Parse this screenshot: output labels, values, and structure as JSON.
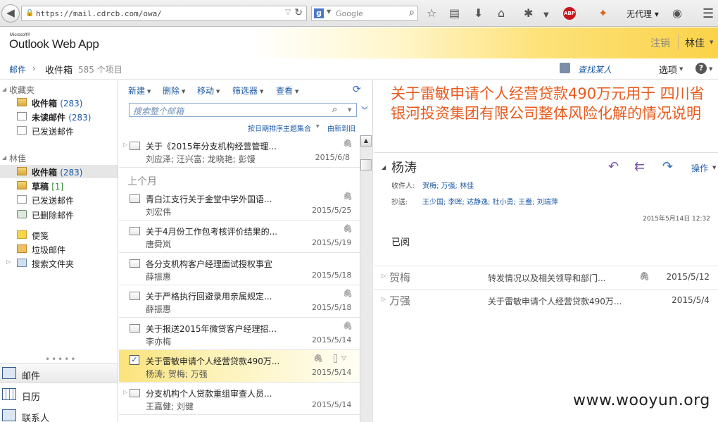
{
  "browser": {
    "url": "https://mail.cdrcb.com/owa/",
    "search_placeholder": "Google",
    "search_engine_letter": "g",
    "proxy_label": "无代理 ▾",
    "abp_label": "ABP"
  },
  "header": {
    "logo_small": "Microsoft®",
    "logo_big": "Outlook Web App",
    "signout": "注销",
    "username": "林佳"
  },
  "breadcrumb": {
    "mail": "邮件",
    "inbox": "收件箱",
    "count": "585 个项目",
    "find_person": "查找某人",
    "options": "选项"
  },
  "nav": {
    "favorites_title": "收藏夹",
    "favorites": [
      {
        "label": "收件箱",
        "count": "(283)",
        "bold": true
      },
      {
        "label": "未读邮件",
        "count": "(283)",
        "bold": true
      },
      {
        "label": "已发送邮件",
        "count": "",
        "bold": false
      }
    ],
    "mailbox_title": "林佳",
    "mailbox": [
      {
        "label": "收件箱",
        "count": "(283)",
        "bold": true
      },
      {
        "label": "草稿",
        "count": "[1]",
        "bold": true
      },
      {
        "label": "已发送邮件",
        "count": "",
        "bold": false
      },
      {
        "label": "已删除邮件",
        "count": "",
        "bold": false
      },
      {
        "label": "便笺",
        "count": "",
        "bold": false
      },
      {
        "label": "垃圾邮件",
        "count": "",
        "bold": false
      },
      {
        "label": "搜索文件夹",
        "count": "",
        "bold": false
      }
    ],
    "modules": [
      {
        "label": "邮件"
      },
      {
        "label": "日历"
      },
      {
        "label": "联系人"
      }
    ]
  },
  "list": {
    "toolbar": {
      "new": "新建",
      "delete": "删除",
      "move": "移动",
      "filter": "筛选器",
      "view": "查看"
    },
    "search_placeholder": "搜索整个邮箱",
    "sort_label": "按日期排序主题集合",
    "sort_order": "由新到旧",
    "group_header": "上个月",
    "messages": [
      {
        "subject": "关于《2015年分支机构经营管理...",
        "from": "刘应泽; 汪兴富; 龙晓艳; 彭馒",
        "date": "2015/6/8"
      },
      {
        "subject": "青白江支行关于金堂中学外国语...",
        "from": "刘宏伟",
        "date": "2015/5/25"
      },
      {
        "subject": "关于4月份工作包考核评价结果的...",
        "from": "唐舜岚",
        "date": "2015/5/19"
      },
      {
        "subject": "各分支机构客户经理面试授权事宜",
        "from": "薛振惠",
        "date": "2015/5/18"
      },
      {
        "subject": "关于严格执行回避录用亲属规定...",
        "from": "薛振惠",
        "date": "2015/5/18"
      },
      {
        "subject": "关于报送2015年微贷客户经理招...",
        "from": "李亦梅",
        "date": "2015/5/14"
      },
      {
        "subject": "关于雷敏申请个人经营贷款490万...",
        "from": "杨涛; 贺梅; 万强",
        "date": "2015/5/14"
      },
      {
        "subject": "分支机构个人贷款重组审查人员...",
        "from": "王嘉健; 刘健",
        "date": "2015/5/14"
      }
    ]
  },
  "reading": {
    "title": "关于雷敏申请个人经营贷款490万元用于 四川省银河投资集团有限公司整体风险化解的情况说明",
    "sender": "杨涛",
    "actions": "操作",
    "to_label": "收件人:",
    "to_values": "贺梅; 万强; 林佳",
    "cc_label": "抄送:",
    "cc_values": "王少国; 李晖; 达静逸; 杜小勇; 王鲞; 刘瑞萍",
    "sent_date": "2015年5月14日 12:32",
    "body": "已阅",
    "thread": [
      {
        "sender": "贺梅",
        "subject": "转发情况以及相关领导和部门...",
        "date": "2015/5/12"
      },
      {
        "sender": "万强",
        "subject": "关于雷敏申请个人经营贷款490万...",
        "date": "2015/5/4"
      }
    ]
  },
  "watermark": "www.wooyun.org"
}
